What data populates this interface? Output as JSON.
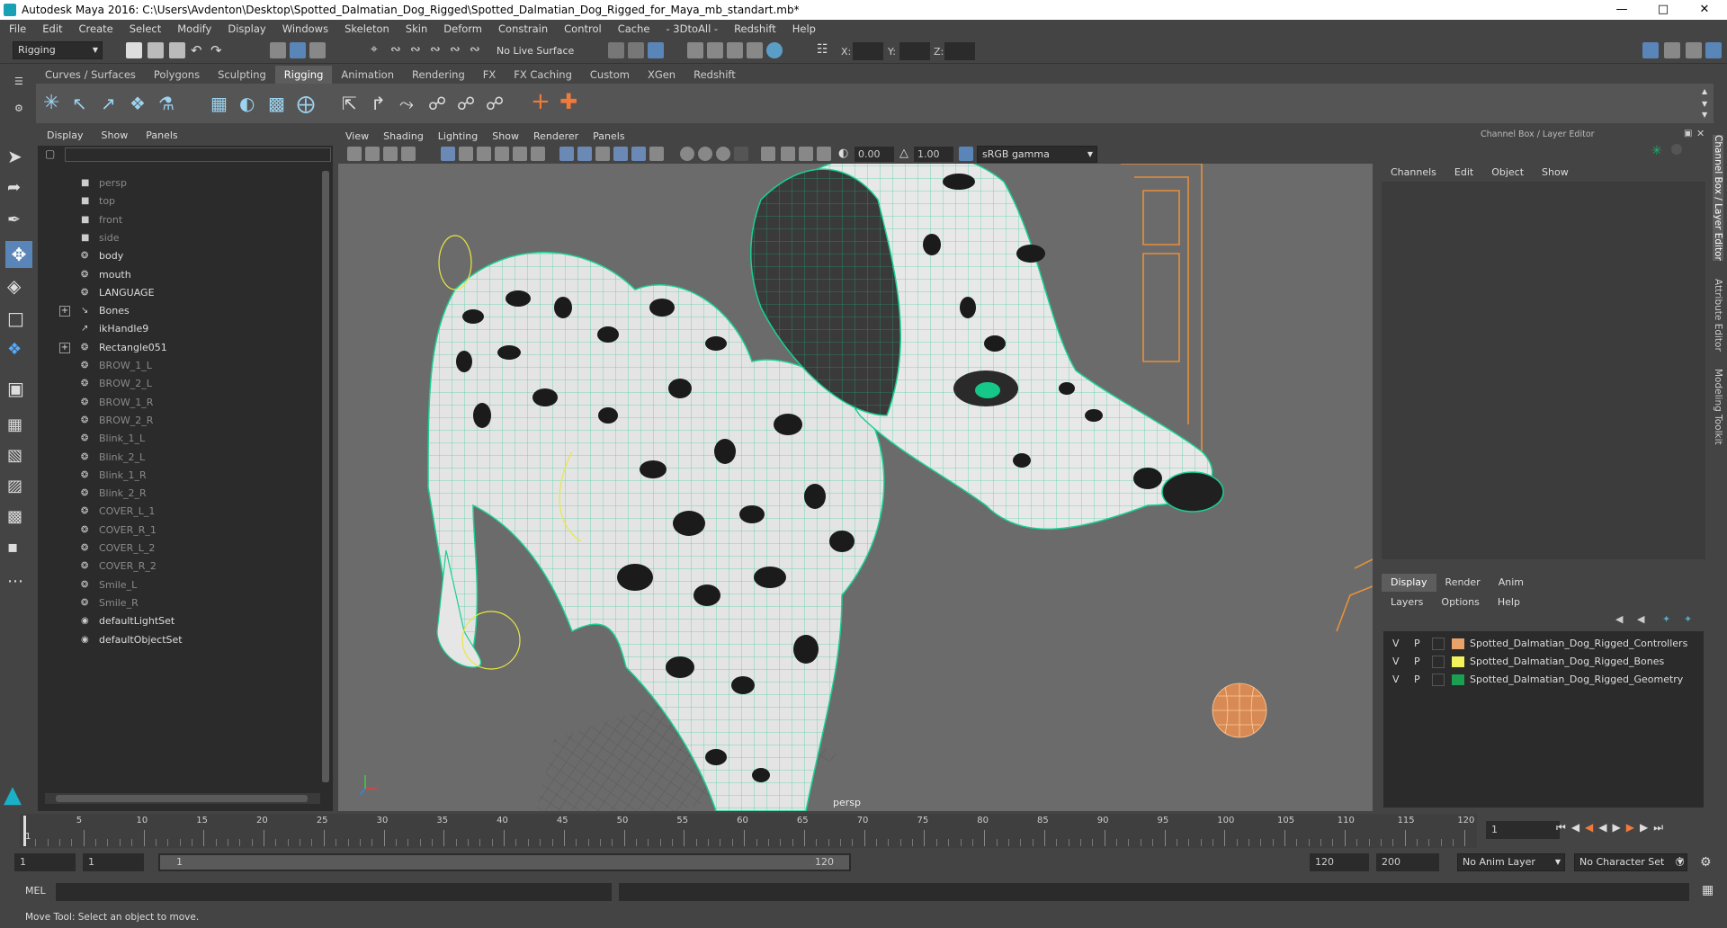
{
  "title": "Autodesk Maya 2016: C:\\Users\\Avdenton\\Desktop\\Spotted_Dalmatian_Dog_Rigged\\Spotted_Dalmatian_Dog_Rigged_for_Maya_mb_standart.mb*",
  "menus": [
    "File",
    "Edit",
    "Create",
    "Select",
    "Modify",
    "Display",
    "Windows",
    "Skeleton",
    "Skin",
    "Deform",
    "Constrain",
    "Control",
    "Cache",
    "- 3DtoAll -",
    "Redshift",
    "Help"
  ],
  "status": {
    "mode": "Rigging",
    "live_surface": "No Live Surface",
    "x_label": "X:",
    "y_label": "Y:",
    "z_label": "Z:"
  },
  "shelf_tabs": [
    "Curves / Surfaces",
    "Polygons",
    "Sculpting",
    "Rigging",
    "Animation",
    "Rendering",
    "FX",
    "FX Caching",
    "Custom",
    "XGen",
    "Redshift"
  ],
  "active_shelf": "Rigging",
  "outliner": {
    "menu": [
      "Display",
      "Show",
      "Panels"
    ],
    "items": [
      {
        "label": "persp",
        "icon": "camera-icon",
        "dim": true
      },
      {
        "label": "top",
        "icon": "camera-icon",
        "dim": true
      },
      {
        "label": "front",
        "icon": "camera-icon",
        "dim": true
      },
      {
        "label": "side",
        "icon": "camera-icon",
        "dim": true
      },
      {
        "label": "body",
        "icon": "transform-icon",
        "dim": false
      },
      {
        "label": "mouth",
        "icon": "transform-icon",
        "dim": false
      },
      {
        "label": "LANGUAGE",
        "icon": "transform-icon",
        "dim": false
      },
      {
        "label": "Bones",
        "icon": "joint-icon",
        "dim": false,
        "expand": true
      },
      {
        "label": "ikHandle9",
        "icon": "ikhandle-icon",
        "dim": false
      },
      {
        "label": "Rectangle051",
        "icon": "transform-icon",
        "dim": false,
        "expand": true
      },
      {
        "label": "BROW_1_L",
        "icon": "transform-icon",
        "dim": true
      },
      {
        "label": "BROW_2_L",
        "icon": "transform-icon",
        "dim": true
      },
      {
        "label": "BROW_1_R",
        "icon": "transform-icon",
        "dim": true
      },
      {
        "label": "BROW_2_R",
        "icon": "transform-icon",
        "dim": true
      },
      {
        "label": "Blink_1_L",
        "icon": "transform-icon",
        "dim": true
      },
      {
        "label": "Blink_2_L",
        "icon": "transform-icon",
        "dim": true
      },
      {
        "label": "Blink_1_R",
        "icon": "transform-icon",
        "dim": true
      },
      {
        "label": "Blink_2_R",
        "icon": "transform-icon",
        "dim": true
      },
      {
        "label": "COVER_L_1",
        "icon": "transform-icon",
        "dim": true
      },
      {
        "label": "COVER_R_1",
        "icon": "transform-icon",
        "dim": true
      },
      {
        "label": "COVER_L_2",
        "icon": "transform-icon",
        "dim": true
      },
      {
        "label": "COVER_R_2",
        "icon": "transform-icon",
        "dim": true
      },
      {
        "label": "Smile_L",
        "icon": "transform-icon",
        "dim": true
      },
      {
        "label": "Smile_R",
        "icon": "transform-icon",
        "dim": true
      },
      {
        "label": "defaultLightSet",
        "icon": "set-icon",
        "dim": false
      },
      {
        "label": "defaultObjectSet",
        "icon": "set-icon",
        "dim": false
      }
    ]
  },
  "viewport": {
    "menu": [
      "View",
      "Shading",
      "Lighting",
      "Show",
      "Renderer",
      "Panels"
    ],
    "exposure": "0.00",
    "gamma": "1.00",
    "color_space": "sRGB gamma",
    "camera_label": "persp"
  },
  "channel_box": {
    "title": "Channel Box / Layer Editor",
    "menu": [
      "Channels",
      "Edit",
      "Object",
      "Show"
    ],
    "tabs": [
      "Display",
      "Render",
      "Anim"
    ],
    "layer_menu": [
      "Layers",
      "Options",
      "Help"
    ],
    "layers": [
      {
        "v": "V",
        "p": "P",
        "color": "#e8a36a",
        "name": "Spotted_Dalmatian_Dog_Rigged_Controllers"
      },
      {
        "v": "V",
        "p": "P",
        "color": "#f2f25a",
        "name": "Spotted_Dalmatian_Dog_Rigged_Bones"
      },
      {
        "v": "V",
        "p": "P",
        "color": "#1aa050",
        "name": "Spotted_Dalmatian_Dog_Rigged_Geometry"
      }
    ]
  },
  "side_tabs": [
    "Channel Box / Layer Editor",
    "Attribute Editor",
    "Modeling Toolkit"
  ],
  "timeline": {
    "ticks": [
      "5",
      "10",
      "15",
      "20",
      "25",
      "30",
      "35",
      "40",
      "45",
      "50",
      "55",
      "60",
      "65",
      "70",
      "75",
      "80",
      "85",
      "90",
      "95",
      "100",
      "105",
      "110",
      "115",
      "120"
    ],
    "start_label": "1",
    "current": "1"
  },
  "range": {
    "start": "1",
    "start2": "1",
    "slider_start": "1",
    "slider_end": "120",
    "end": "120",
    "end2": "200",
    "anim_layer": "No Anim Layer",
    "char_set": "No Character Set"
  },
  "mel_label": "MEL",
  "help": "Move Tool: Select an object to move."
}
